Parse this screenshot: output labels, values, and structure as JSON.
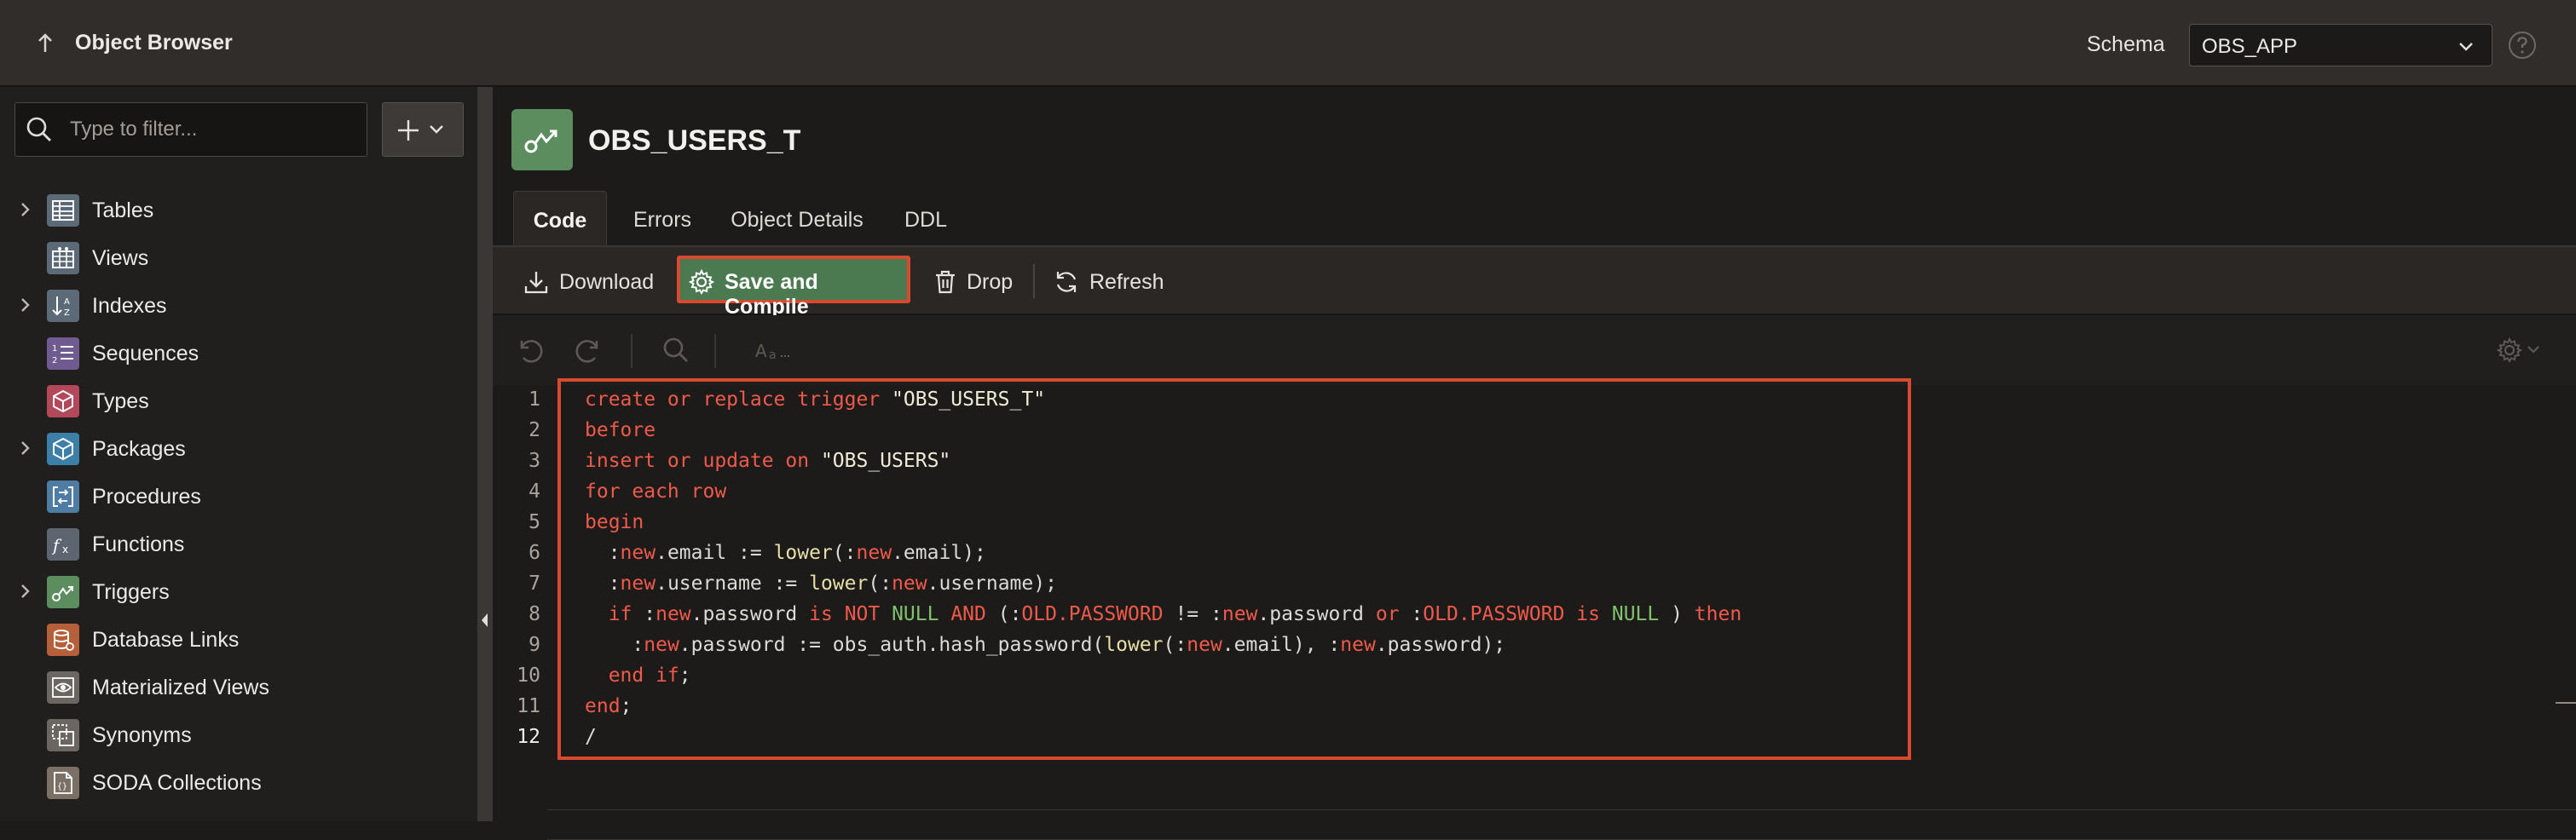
{
  "header": {
    "title": "Object Browser",
    "schema_label": "Schema",
    "schema_value": "OBS_APP"
  },
  "sidebar": {
    "filter_placeholder": "Type to filter...",
    "items": [
      {
        "label": "Tables",
        "expandable": true
      },
      {
        "label": "Views",
        "expandable": false
      },
      {
        "label": "Indexes",
        "expandable": true
      },
      {
        "label": "Sequences",
        "expandable": false
      },
      {
        "label": "Types",
        "expandable": false
      },
      {
        "label": "Packages",
        "expandable": true
      },
      {
        "label": "Procedures",
        "expandable": false
      },
      {
        "label": "Functions",
        "expandable": false
      },
      {
        "label": "Triggers",
        "expandable": true
      },
      {
        "label": "Database Links",
        "expandable": false
      },
      {
        "label": "Materialized Views",
        "expandable": false
      },
      {
        "label": "Synonyms",
        "expandable": false
      },
      {
        "label": "SODA Collections",
        "expandable": false
      }
    ]
  },
  "object": {
    "name": "OBS_USERS_T",
    "tabs": [
      {
        "label": "Code",
        "active": true
      },
      {
        "label": "Errors",
        "active": false
      },
      {
        "label": "Object Details",
        "active": false
      },
      {
        "label": "DDL",
        "active": false
      }
    ]
  },
  "toolbar": {
    "download": "Download",
    "save_compile": "Save and Compile",
    "drop": "Drop",
    "refresh": "Refresh"
  },
  "editor": {
    "line_numbers": [
      "1",
      "2",
      "3",
      "4",
      "5",
      "6",
      "7",
      "8",
      "9",
      "10",
      "11",
      "12"
    ],
    "current_line": 12
  },
  "colors": {
    "keyword": "#ef5a4a",
    "string": "#efecd8",
    "function": "#e6dfa6",
    "null": "#7fc46c",
    "primary_button": "#4b7a51",
    "highlight": "#d84a2f"
  }
}
